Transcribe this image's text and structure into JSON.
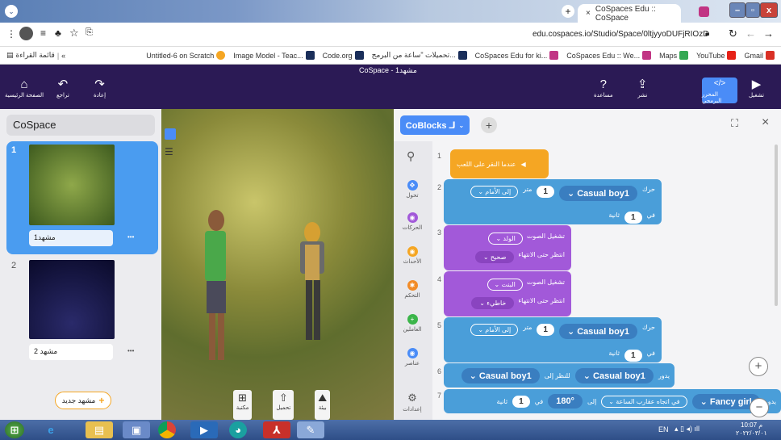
{
  "browser": {
    "tab_title": "CoSpaces Edu :: CoSpace",
    "close_tab": "×",
    "new_tab": "+",
    "url": "edu.cospaces.io/Studio/Space/0ltjyyoDUFjRIOzD",
    "reading_list": "قائمة القراءة",
    "bookmarks": [
      {
        "label": "Untitled-6 on Scratch",
        "color": "#f5a623"
      },
      {
        "label": "Image Model - Teac...",
        "color": "#4a90d9"
      },
      {
        "label": "Code.org",
        "color": "#1a2e5a"
      },
      {
        "label": "تحميلات \"ساعة من البرمج...",
        "color": "#1a2e5a"
      },
      {
        "label": "CoSpaces Edu for ki...",
        "color": "#1a2e5a"
      },
      {
        "label": "CoSpaces Edu :: We...",
        "color": "#c13584"
      },
      {
        "label": "Maps",
        "color": "#34a853"
      },
      {
        "label": "YouTube",
        "color": "#e62117"
      },
      {
        "label": "Gmail",
        "color": "#d93025"
      }
    ]
  },
  "app": {
    "title": "CoSpace - مشهد1",
    "home_label": "الصفحة الرئيسية",
    "undo_label": "تراجع",
    "redo_label": "إعادة",
    "help_label": "مساعدة",
    "share_label": "نشر",
    "code_label": "المحرر البرمجي",
    "play_label": "تشغيل",
    "accent": "#2b1a55",
    "code_accent": "#4a8cf7"
  },
  "left": {
    "heading": "CoSpace",
    "scenes": [
      {
        "number": "1",
        "name": "مشهد1",
        "more": "•••"
      },
      {
        "number": "2",
        "name": "مشهد 2",
        "more": "•••"
      }
    ],
    "new_scene": "مشهد جديد",
    "plus": "+"
  },
  "bottom_tools": [
    {
      "label": "مكتبة",
      "icon": "library-icon"
    },
    {
      "label": "تحميل",
      "icon": "upload-icon"
    },
    {
      "label": "بيئة",
      "icon": "environment-icon"
    }
  ],
  "coblocks": {
    "tab_label": "CoBlocks لـ",
    "add_tab": "+",
    "categories": [
      {
        "label": "تحول",
        "color": "#4a8cf7"
      },
      {
        "label": "الحركات",
        "color": "#a259d9"
      },
      {
        "label": "الأحداث",
        "color": "#f5a623"
      },
      {
        "label": "التحكم",
        "color": "#f28c28"
      },
      {
        "label": "العاملين",
        "color": "#3bb54a"
      },
      {
        "label": "عناصر",
        "color": "#4a8cf7"
      },
      {
        "label": "إعدادات",
        "color": "#666666"
      }
    ],
    "lines": [
      "1",
      "2",
      "3",
      "4",
      "5",
      "6",
      "7"
    ],
    "blocks": {
      "b1_text": "عندما النقر على اللعب",
      "b2_move": "حرك",
      "b2_obj": "Casual boy1",
      "b2_amt": "1",
      "b2_unit": "متر",
      "b2_dir": "إلى الأمام",
      "b2_in": "في",
      "b2_time": "1",
      "b2_sec": "ثانية",
      "b3_play": "تشغيل الصوت",
      "b3_who": "الولد",
      "b3_sound": "صحيح",
      "b3_wait": "انتظر حتى الانتهاء",
      "b4_play": "تشغيل الصوت",
      "b4_who": "البنت",
      "b4_sound": "خاطيء",
      "b4_wait": "انتظر حتى الانتهاء",
      "b5_move": "حرك",
      "b5_obj": "Casual boy1",
      "b5_amt": "1",
      "b5_unit": "متر",
      "b5_dir": "إلى الأمام",
      "b5_in": "في",
      "b5_time": "1",
      "b5_sec": "ثانية",
      "b6_rot": "يدور",
      "b6_obj": "Casual boy1",
      "b6_look": "للنظر إلى",
      "b6_target": "Casual boy1",
      "b7_rot": "يدور",
      "b7_obj": "Fancy girl",
      "b7_to": "إلى",
      "b7_dir": "في اتجاه عقارب الساعة",
      "b7_deg": "180°",
      "b7_in": "في",
      "b7_time": "1",
      "b7_sec": "ثانية"
    }
  },
  "taskbar": {
    "lang": "EN",
    "time": "10:07 م",
    "date": "٢٠٢٢/٠٣/٠١"
  }
}
